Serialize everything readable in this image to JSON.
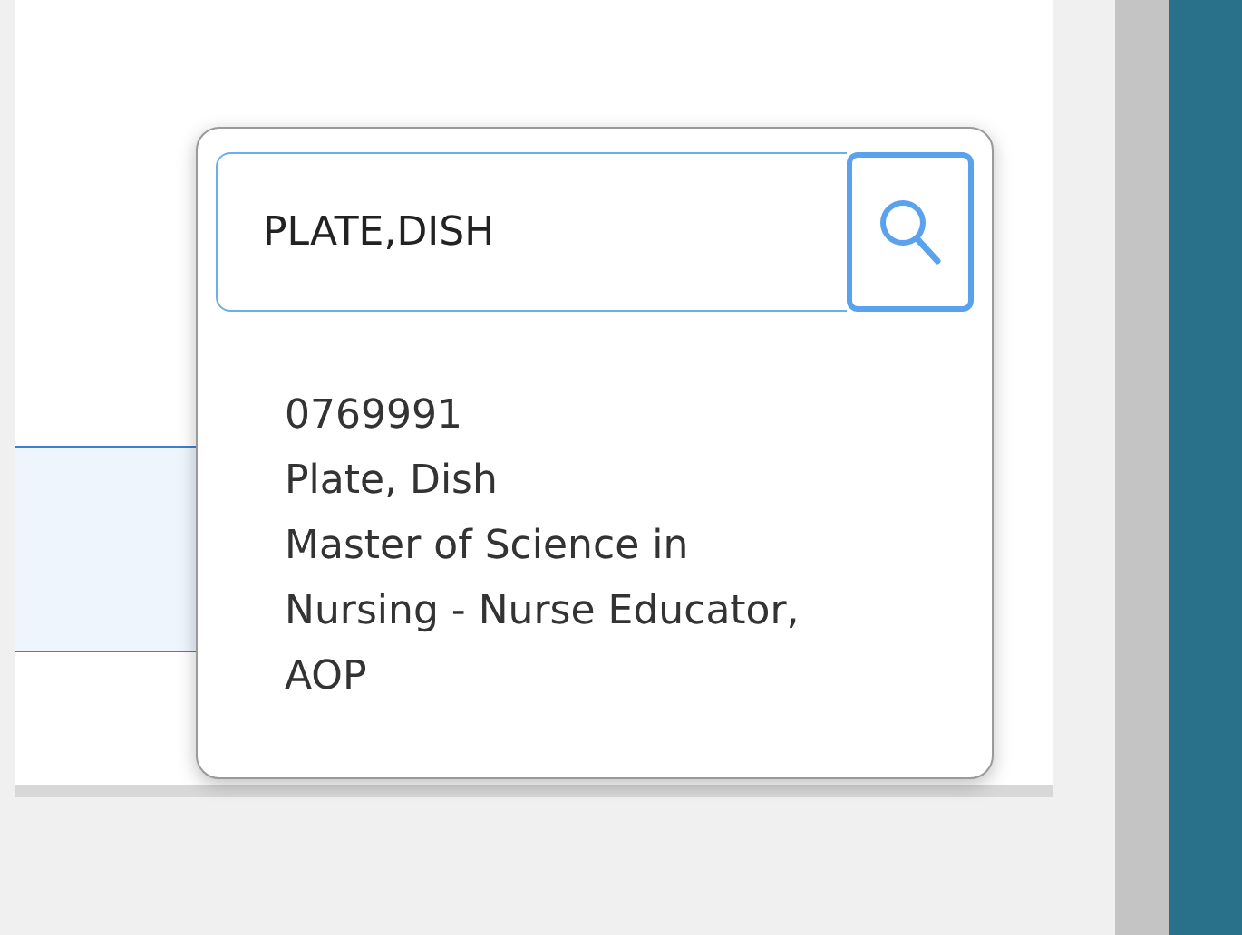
{
  "search": {
    "value": "PLATE,DISH"
  },
  "results": [
    {
      "id": "0769991",
      "name": "Plate, Dish",
      "program": "Master of Science in Nursing - Nurse Educator, AOP"
    }
  ]
}
